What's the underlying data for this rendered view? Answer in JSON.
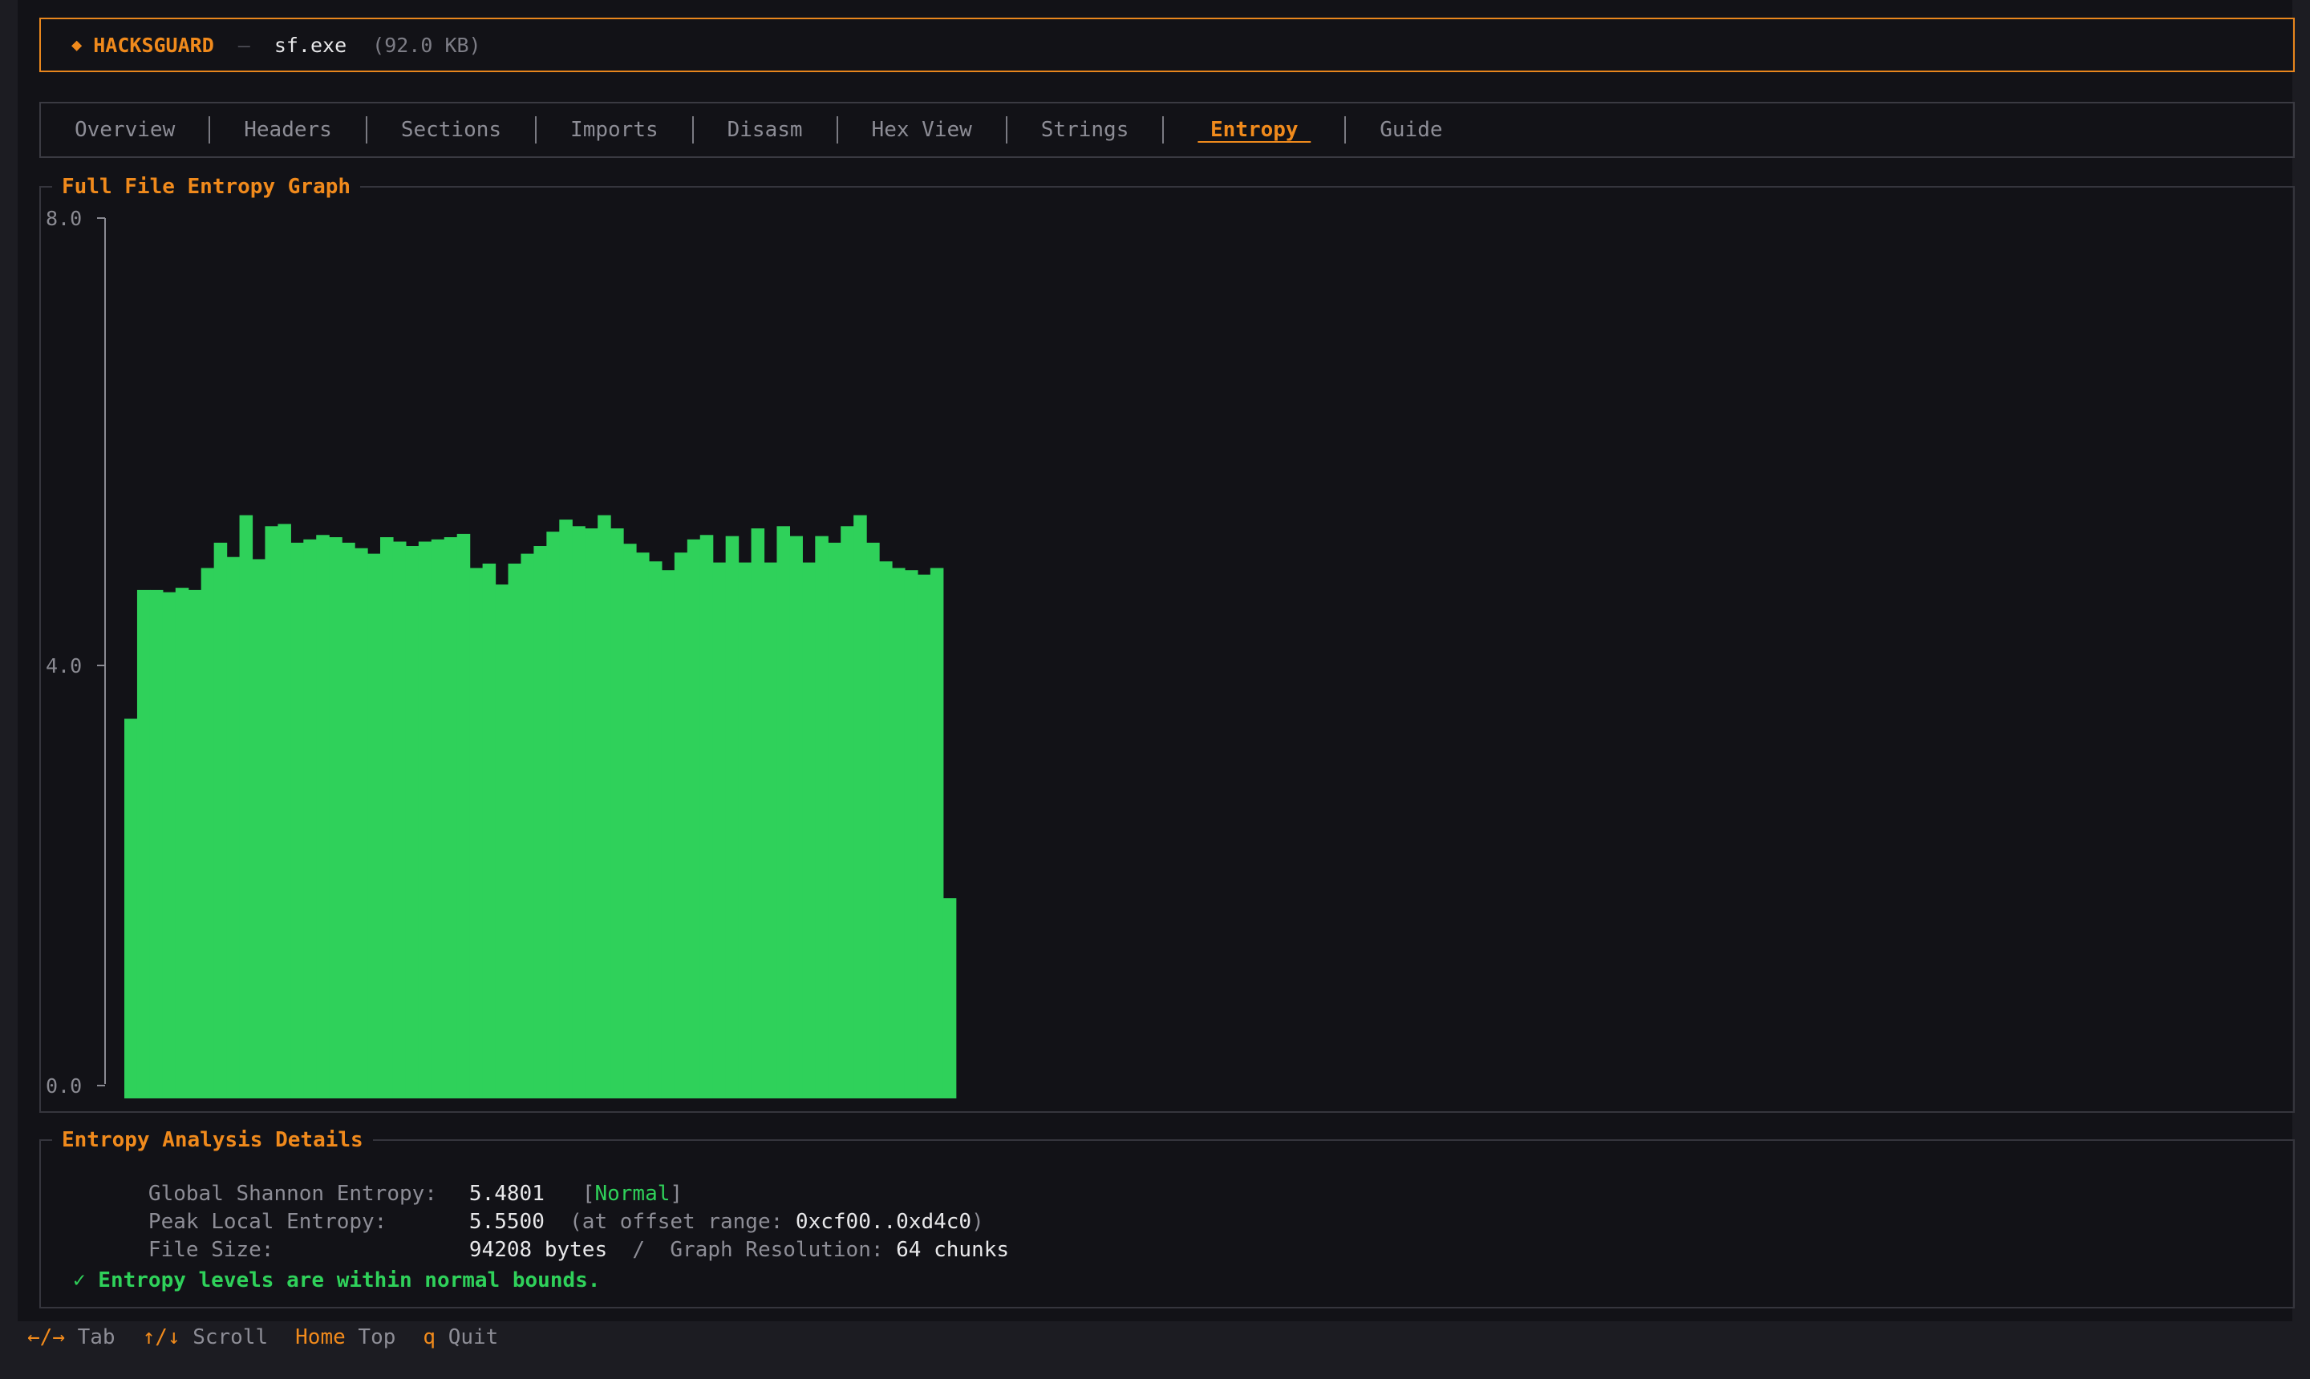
{
  "titlebar": {
    "brand": "HACKSGUARD",
    "separator": "—",
    "filename": "sf.exe",
    "filesize": "(92.0 KB)"
  },
  "tabs": [
    {
      "label": "Overview",
      "active": false
    },
    {
      "label": "Headers",
      "active": false
    },
    {
      "label": "Sections",
      "active": false
    },
    {
      "label": "Imports",
      "active": false
    },
    {
      "label": "Disasm",
      "active": false
    },
    {
      "label": "Hex View",
      "active": false
    },
    {
      "label": "Strings",
      "active": false
    },
    {
      "label": " Entropy ",
      "active": true
    },
    {
      "label": "Guide",
      "active": false
    }
  ],
  "graph": {
    "title": "Full File Entropy Graph"
  },
  "chart_data": {
    "type": "bar",
    "title": "Full File Entropy Graph",
    "xlabel": "",
    "ylabel": "",
    "ylim": [
      0,
      8
    ],
    "yticks": [
      "8.0",
      "4.0",
      "0.0"
    ],
    "grid": false,
    "color": "#2fd15a",
    "values": [
      3.45,
      4.62,
      4.62,
      4.6,
      4.64,
      4.62,
      4.82,
      5.05,
      4.92,
      5.3,
      4.9,
      5.2,
      5.22,
      5.05,
      5.08,
      5.12,
      5.1,
      5.05,
      5.0,
      4.95,
      5.1,
      5.06,
      5.02,
      5.06,
      5.08,
      5.1,
      5.13,
      4.82,
      4.86,
      4.67,
      4.86,
      4.95,
      5.02,
      5.15,
      5.26,
      5.2,
      5.18,
      5.3,
      5.18,
      5.04,
      4.96,
      4.88,
      4.8,
      4.96,
      5.08,
      5.12,
      4.87,
      5.11,
      4.87,
      5.18,
      4.87,
      5.2,
      5.11,
      4.87,
      5.11,
      5.05,
      5.2,
      5.3,
      5.05,
      4.88,
      4.82,
      4.8,
      4.76,
      4.82,
      1.82
    ]
  },
  "details": {
    "title": "Entropy Analysis Details",
    "global_label": "Global Shannon Entropy:",
    "global_value": "5.4801",
    "global_status_open": "[",
    "global_status": "Normal",
    "global_status_close": "]",
    "peak_label": "Peak Local Entropy:",
    "peak_value": "5.5500",
    "peak_range_prefix": "(at offset range: ",
    "peak_range": "0xcf00..0xd4c0",
    "peak_range_suffix": ")",
    "filesize_label": "File Size:",
    "filesize_value": "94208 bytes",
    "slash": "/",
    "resolution_label": "Graph Resolution:",
    "resolution_value": "64 chunks",
    "status_message": "✓ Entropy levels are within normal bounds."
  },
  "footer": [
    {
      "key": "←/→",
      "desc": "Tab"
    },
    {
      "key": "↑/↓",
      "desc": "Scroll"
    },
    {
      "key": "Home",
      "desc": "Top"
    },
    {
      "key": "q",
      "desc": "Quit"
    }
  ]
}
